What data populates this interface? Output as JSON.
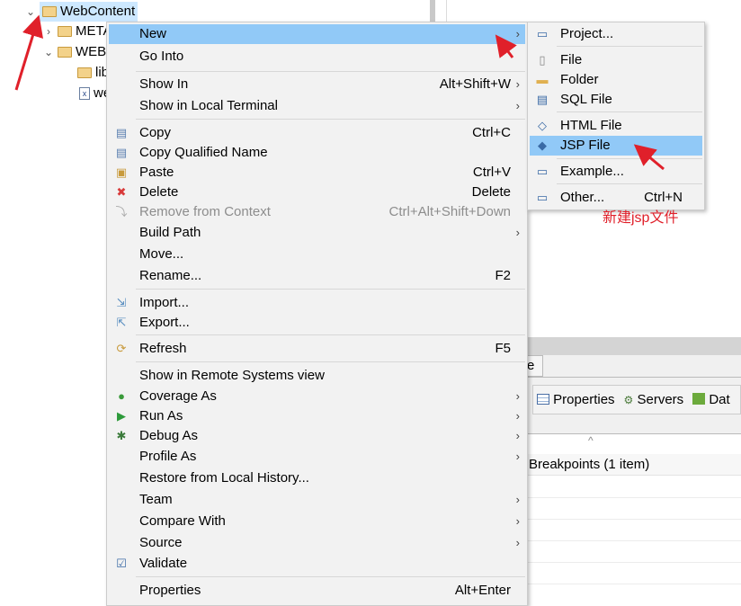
{
  "tree": {
    "root": "WebContent",
    "children": [
      {
        "label": "META-INF",
        "shown": "MET"
      },
      {
        "label": "WEB-INF",
        "shown": "WEB"
      },
      {
        "label": "lib",
        "shown": "li"
      },
      {
        "label": "web.xml",
        "shown": "w"
      }
    ]
  },
  "context_menu": [
    {
      "label": "New",
      "shortcut": "",
      "submenu": true,
      "highlighted": true
    },
    {
      "label": "Go Into"
    },
    {
      "sep": true
    },
    {
      "label": "Show In",
      "shortcut": "Alt+Shift+W",
      "submenu": true
    },
    {
      "label": "Show in Local Terminal",
      "submenu": true
    },
    {
      "sep": true
    },
    {
      "label": "Copy",
      "shortcut": "Ctrl+C",
      "icon": "copy-icon"
    },
    {
      "label": "Copy Qualified Name",
      "icon": "copy-qualified-icon"
    },
    {
      "label": "Paste",
      "shortcut": "Ctrl+V",
      "icon": "paste-icon"
    },
    {
      "label": "Delete",
      "shortcut": "Delete",
      "icon": "delete-icon"
    },
    {
      "label": "Remove from Context",
      "shortcut": "Ctrl+Alt+Shift+Down",
      "disabled": true,
      "icon": "remove-context-icon"
    },
    {
      "label": "Build Path",
      "submenu": true
    },
    {
      "label": "Move..."
    },
    {
      "label": "Rename...",
      "shortcut": "F2"
    },
    {
      "sep": true
    },
    {
      "label": "Import...",
      "icon": "import-icon"
    },
    {
      "label": "Export...",
      "icon": "export-icon"
    },
    {
      "sep": true
    },
    {
      "label": "Refresh",
      "shortcut": "F5",
      "icon": "refresh-icon"
    },
    {
      "sep": true
    },
    {
      "label": "Show in Remote Systems view"
    },
    {
      "label": "Coverage As",
      "submenu": true,
      "icon": "coverage-icon"
    },
    {
      "label": "Run As",
      "submenu": true,
      "icon": "run-icon"
    },
    {
      "label": "Debug As",
      "submenu": true,
      "icon": "debug-icon"
    },
    {
      "label": "Profile As",
      "submenu": true
    },
    {
      "label": "Restore from Local History..."
    },
    {
      "label": "Team",
      "submenu": true
    },
    {
      "label": "Compare With",
      "submenu": true
    },
    {
      "label": "Source",
      "submenu": true
    },
    {
      "label": "Validate",
      "icon": "checkbox-icon"
    },
    {
      "sep": true
    },
    {
      "label": "Properties",
      "shortcut": "Alt+Enter"
    }
  ],
  "new_submenu": [
    {
      "label": "Project...",
      "icon": "new-project-icon"
    },
    {
      "sep": true
    },
    {
      "label": "File",
      "icon": "new-file-icon"
    },
    {
      "label": "Folder",
      "icon": "new-folder-icon"
    },
    {
      "label": "SQL File",
      "icon": "sql-file-icon"
    },
    {
      "sep": true
    },
    {
      "label": "HTML File",
      "icon": "html-file-icon"
    },
    {
      "label": "JSP File",
      "icon": "jsp-file-icon",
      "highlighted": true
    },
    {
      "sep": true
    },
    {
      "label": "Example...",
      "icon": "example-icon"
    },
    {
      "sep": true
    },
    {
      "label": "Other...",
      "shortcut": "Ctrl+N",
      "icon": "other-icon"
    }
  ],
  "annotation": "新建jsp文件",
  "bottom_panel": {
    "partial_tab": "e",
    "tabs": [
      "Properties",
      "Servers",
      "Dat"
    ],
    "breakpoints_label": "Breakpoints (1 item)"
  },
  "colors": {
    "highlight": "#91c9f7",
    "annotation": "#e0202a",
    "menu_bg": "#f2f2f2"
  }
}
